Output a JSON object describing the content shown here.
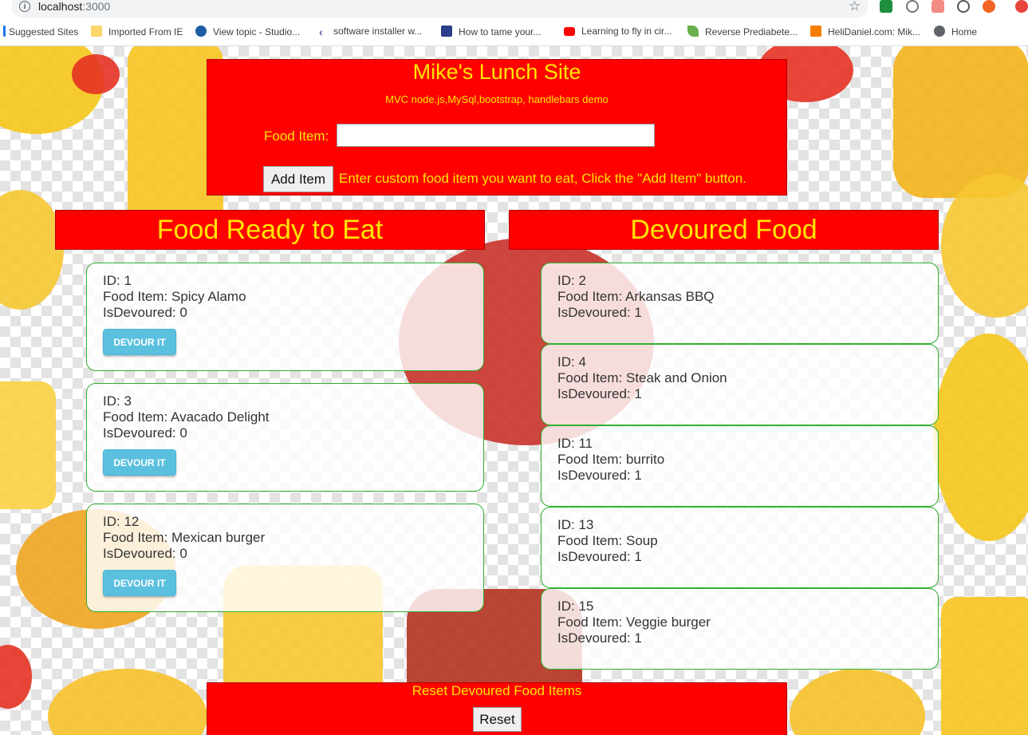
{
  "browser": {
    "url_host": "localhost",
    "url_port": ":3000",
    "bookmarks": [
      {
        "label": "Suggested Sites",
        "icon": "suggested-sites-icon"
      },
      {
        "label": "Imported From IE",
        "icon": "folder-icon"
      },
      {
        "label": "View topic - Studio...",
        "icon": "forum-icon"
      },
      {
        "label": "software installer w...",
        "icon": "visual-studio-icon"
      },
      {
        "label": "How to tame your...",
        "icon": "flag-icon"
      },
      {
        "label": "Learning to fly in cir...",
        "icon": "youtube-icon"
      },
      {
        "label": "Reverse Prediabete...",
        "icon": "leaf-icon"
      },
      {
        "label": "HeliDaniel.com: Mik...",
        "icon": "blogger-icon"
      },
      {
        "label": "Home",
        "icon": "globe-icon"
      }
    ]
  },
  "header": {
    "title": "Mike's Lunch Site",
    "subtitle": "MVC node.js,MySql,bootstrap, handlebars demo",
    "food_label": "Food Item:",
    "food_input_value": "",
    "add_button": "Add Item",
    "help_text": "Enter custom food item you want to eat, Click the \"Add Item\" button."
  },
  "ready": {
    "heading": "Food Ready to Eat",
    "button_label": "DEVOUR IT",
    "items": [
      {
        "id": "ID: 1",
        "name": "Food Item: Spicy Alamo",
        "devoured": "IsDevoured: 0"
      },
      {
        "id": "ID: 3",
        "name": "Food Item: Avacado Delight",
        "devoured": "IsDevoured: 0"
      },
      {
        "id": "ID: 12",
        "name": "Food Item: Mexican burger",
        "devoured": "IsDevoured: 0"
      }
    ]
  },
  "devoured": {
    "heading": "Devoured Food",
    "items": [
      {
        "id": "ID: 2",
        "name": "Food Item: Arkansas BBQ",
        "devoured": "IsDevoured: 1"
      },
      {
        "id": "ID: 4",
        "name": "Food Item: Steak and Onion",
        "devoured": "IsDevoured: 1"
      },
      {
        "id": "ID: 11",
        "name": "Food Item: burrito",
        "devoured": "IsDevoured: 1"
      },
      {
        "id": "ID: 13",
        "name": "Food Item: Soup",
        "devoured": "IsDevoured: 1"
      },
      {
        "id": "ID: 15",
        "name": "Food Item: Veggie burger",
        "devoured": "IsDevoured: 1"
      }
    ]
  },
  "footer": {
    "title": "Reset Devoured Food Items",
    "reset_button": "Reset"
  },
  "colors": {
    "panel_red": "#ff0000",
    "text_yellow": "#ffe600",
    "card_border_green": "#2fb12f",
    "devour_button": "#5bc0de"
  }
}
